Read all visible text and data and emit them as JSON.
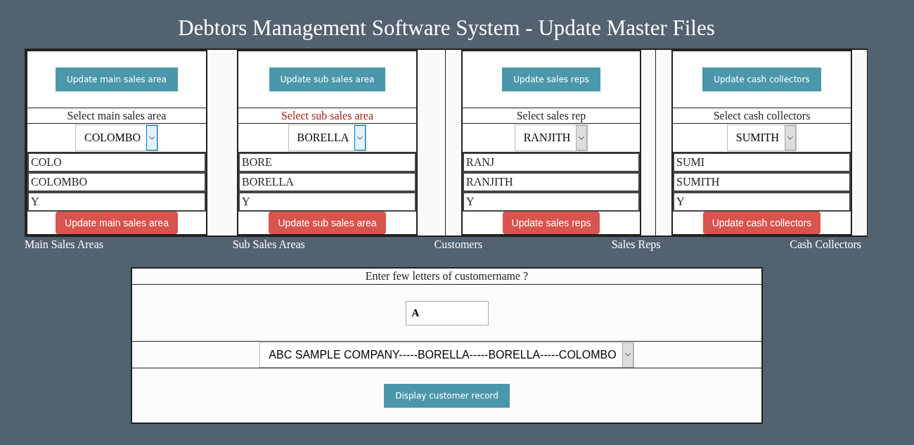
{
  "title": "Debtors Management Software System - Update Master Files",
  "panels": [
    {
      "top_button": "Update main sales area",
      "prompt": "Select main sales area",
      "prompt_alert": false,
      "select": {
        "value": "COLOMBO",
        "highlighted": true
      },
      "fields": [
        "COLO",
        "COLOMBO",
        "Y"
      ],
      "bottom_button": "Update main sales area"
    },
    {
      "top_button": "Update sub sales area",
      "prompt": "Select sub sales area",
      "prompt_alert": true,
      "select": {
        "value": "BORELLA",
        "highlighted": true
      },
      "fields": [
        "BORE",
        "BORELLA",
        "Y"
      ],
      "bottom_button": "Update sub sales area"
    },
    {
      "top_button": "Update sales reps",
      "prompt": "Select sales rep",
      "prompt_alert": false,
      "select": {
        "value": "RANJITH",
        "highlighted": false
      },
      "fields": [
        "RANJ",
        "RANJITH",
        "Y"
      ],
      "bottom_button": "Update sales reps"
    },
    {
      "top_button": "Update cash collectors",
      "prompt": "Select cash collectors",
      "prompt_alert": false,
      "select": {
        "value": "SUMITH",
        "highlighted": false
      },
      "fields": [
        "SUMI",
        "SUMITH",
        "Y"
      ],
      "bottom_button": "Update cash collectors"
    }
  ],
  "section_labels": [
    "Main Sales Areas",
    "Sub Sales Areas",
    "Customers",
    "Sales Reps",
    "Cash Collectors"
  ],
  "customer_search": {
    "prompt": "Enter few letters of customername ?",
    "value": "A",
    "select": {
      "value": "ABC SAMPLE COMPANY-----BORELLA-----BORELLA-----COLOMBO"
    },
    "button": "Display customer record"
  }
}
